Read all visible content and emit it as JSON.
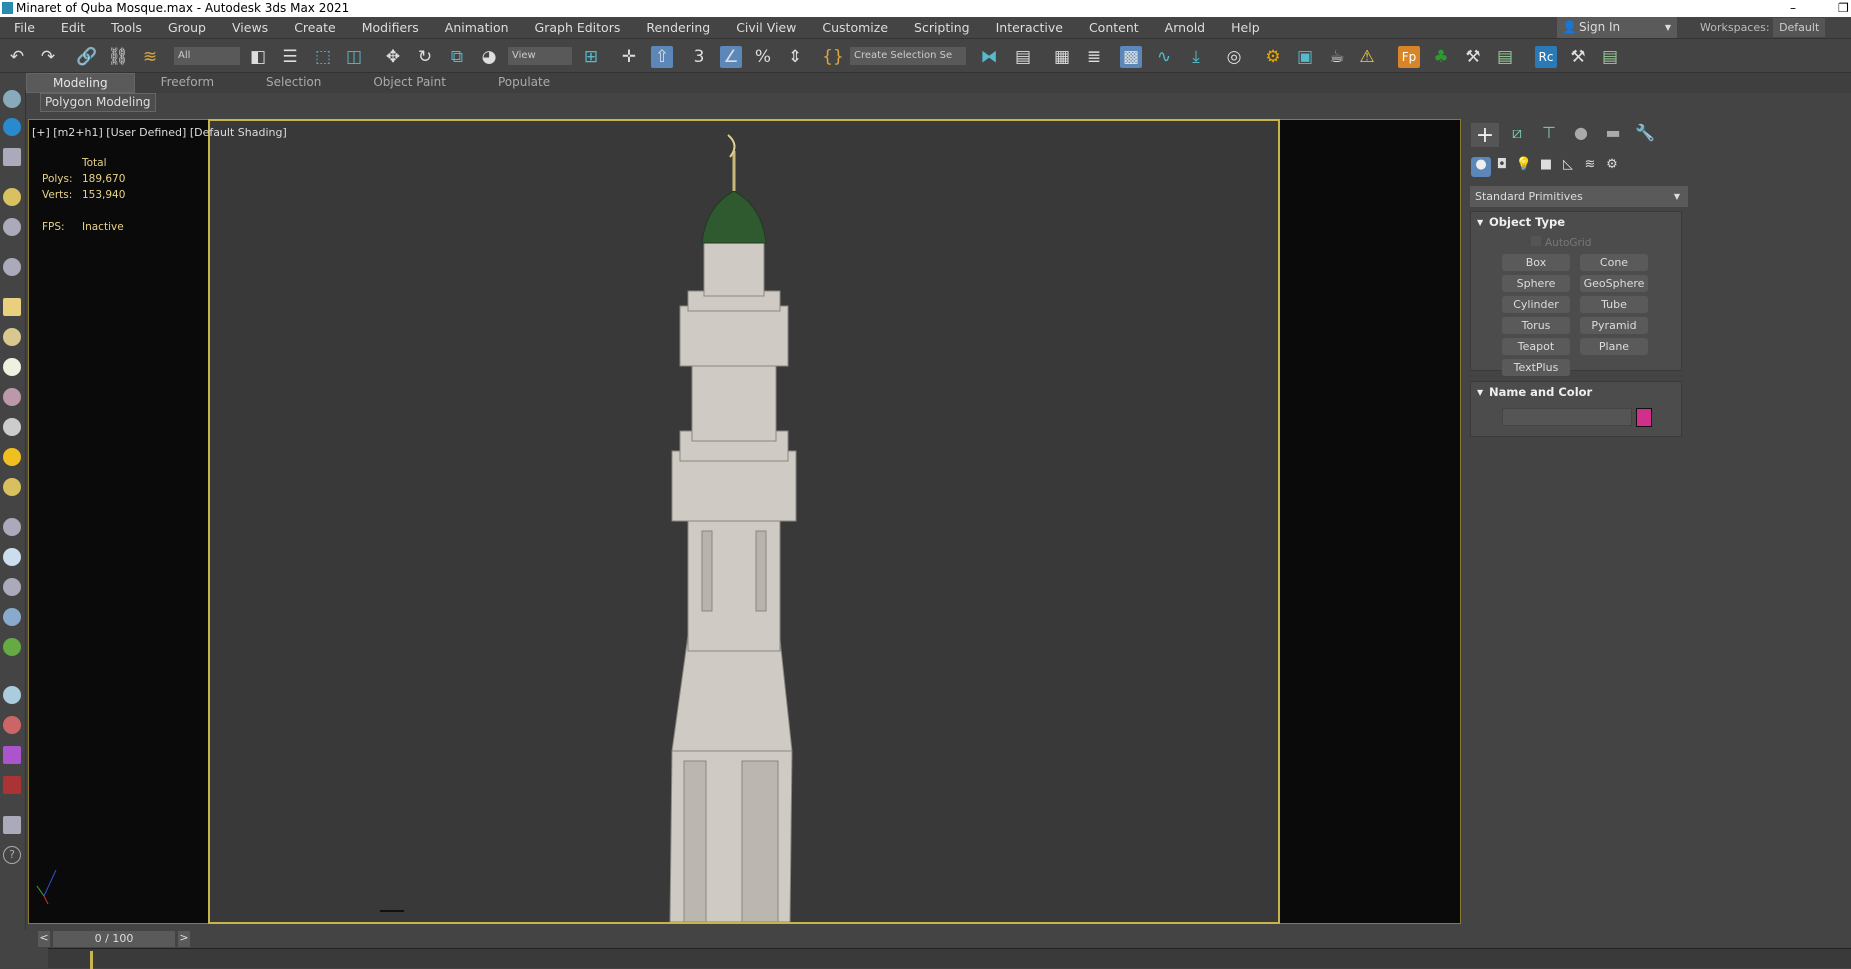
{
  "window": {
    "title": "Minaret of Quba Mosque.max - Autodesk 3ds Max 2021",
    "minimize": "–",
    "restore": "❐"
  },
  "menu": [
    "File",
    "Edit",
    "Tools",
    "Group",
    "Views",
    "Create",
    "Modifiers",
    "Animation",
    "Graph Editors",
    "Rendering",
    "Civil View",
    "Customize",
    "Scripting",
    "Interactive",
    "Content",
    "Arnold",
    "Help"
  ],
  "account": {
    "sign_in": "Sign In",
    "workspaces_label": "Workspaces:",
    "workspace": "Default"
  },
  "toolbar": {
    "selection_filter": "All",
    "ref_coord": "View",
    "named_selection": "Create Selection Se"
  },
  "ribbon": {
    "tabs": [
      "Modeling",
      "Freeform",
      "Selection",
      "Object Paint",
      "Populate"
    ],
    "active": "Modeling",
    "panel": "Polygon Modeling"
  },
  "viewport": {
    "label": "[+] [m2+h1] [User Defined] [Default Shading]",
    "stats": {
      "header": "Total",
      "polys_label": "Polys:",
      "polys": "189,670",
      "verts_label": "Verts:",
      "verts": "153,940",
      "fps_label": "FPS:",
      "fps": "Inactive"
    }
  },
  "command_panel": {
    "category": "Standard Primitives",
    "object_type": {
      "title": "Object Type",
      "autogrid": "AutoGrid",
      "buttons": [
        "Box",
        "Cone",
        "Sphere",
        "GeoSphere",
        "Cylinder",
        "Tube",
        "Torus",
        "Pyramid",
        "Teapot",
        "Plane",
        "TextPlus"
      ]
    },
    "name_color": {
      "title": "Name and Color",
      "name_value": "",
      "color": "#d0308a"
    }
  },
  "timeline": {
    "frame": "0 / 100",
    "prev": "<",
    "next": ">"
  }
}
